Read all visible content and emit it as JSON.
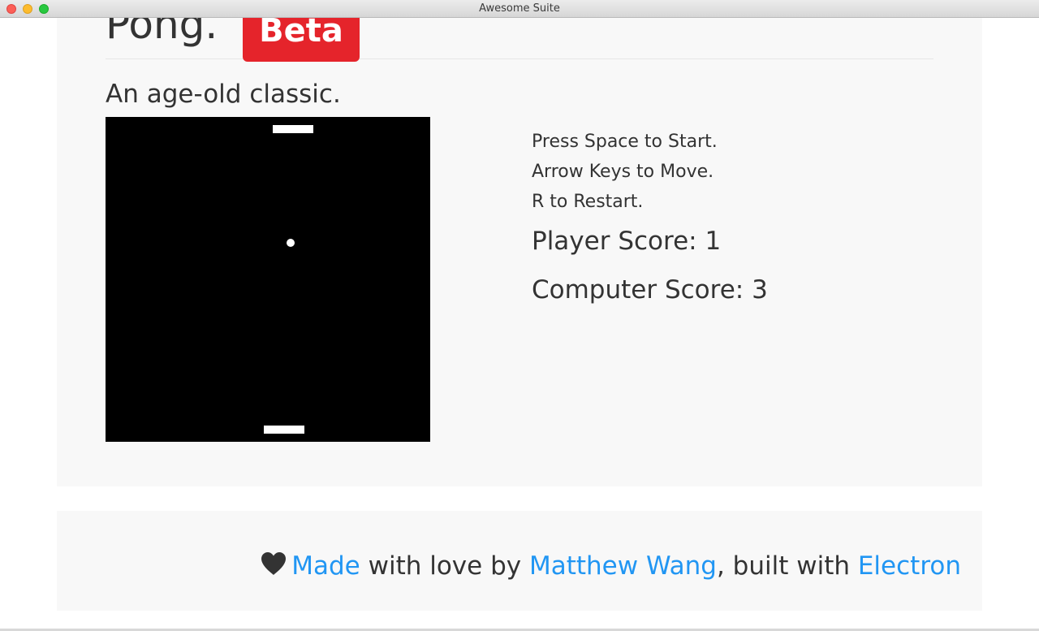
{
  "window": {
    "title": "Awesome Suite"
  },
  "header": {
    "title": "Pong.",
    "badge": "Beta"
  },
  "subtitle": "An age-old classic.",
  "game": {
    "player_paddle": "bottom",
    "computer_paddle": "top",
    "ball_color": "#ffffff",
    "background_color": "#000000"
  },
  "instructions": [
    "Press Space to Start.",
    "Arrow Keys to Move.",
    "R to Restart."
  ],
  "scores": {
    "player": "Player Score: 1",
    "computer": "Computer Score: 3"
  },
  "footer": {
    "icon": "heart-icon",
    "made_link": "Made",
    "text_with_love_by": " with love by ",
    "author_link": "Matthew Wang",
    "text_built_with": ", built with ",
    "electron_link": "Electron"
  },
  "colors": {
    "accent_link": "#2196f3",
    "badge": "#e5242b",
    "text": "#333333",
    "panel": "#f8f8f8"
  }
}
